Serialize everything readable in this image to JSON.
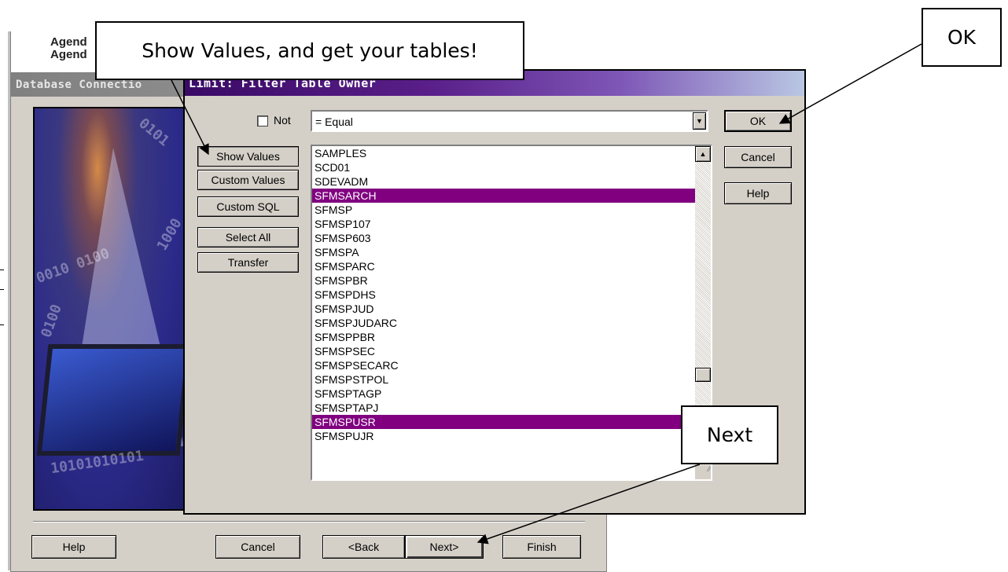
{
  "background": {
    "agency_lines": [
      "Agend",
      "Agend"
    ],
    "window_title": "Database Connectio",
    "hero_binary": [
      "0101",
      "1000",
      "0010 0100",
      "0100",
      "10101010101"
    ],
    "buttons": {
      "help": "Help",
      "cancel": "Cancel",
      "back": "<Back",
      "next": "Next>",
      "finish": "Finish"
    }
  },
  "dialog": {
    "title": "Limit: Filter Table Owner",
    "not_label": "Not",
    "operator_value": "= Equal",
    "side_buttons": [
      "Show Values",
      "Custom Values",
      "Custom SQL",
      "Select All",
      "Transfer"
    ],
    "right_buttons": {
      "ok": "OK",
      "cancel": "Cancel",
      "help": "Help"
    },
    "list_items": [
      {
        "text": "SAMPLES",
        "selected": false
      },
      {
        "text": "SCD01",
        "selected": false
      },
      {
        "text": "SDEVADM",
        "selected": false
      },
      {
        "text": "SFMSARCH",
        "selected": true
      },
      {
        "text": "SFMSP",
        "selected": false
      },
      {
        "text": "SFMSP107",
        "selected": false
      },
      {
        "text": "SFMSP603",
        "selected": false
      },
      {
        "text": "SFMSPA",
        "selected": false
      },
      {
        "text": "SFMSPARC",
        "selected": false
      },
      {
        "text": "SFMSPBR",
        "selected": false
      },
      {
        "text": "SFMSPDHS",
        "selected": false
      },
      {
        "text": "SFMSPJUD",
        "selected": false
      },
      {
        "text": "SFMSPJUDARC",
        "selected": false
      },
      {
        "text": "SFMSPPBR",
        "selected": false
      },
      {
        "text": "SFMSPSEC",
        "selected": false
      },
      {
        "text": "SFMSPSECARC",
        "selected": false
      },
      {
        "text": "SFMSPSTPOL",
        "selected": false
      },
      {
        "text": "SFMSPTAGP",
        "selected": false
      },
      {
        "text": "SFMSPTAPJ",
        "selected": false
      },
      {
        "text": "SFMSPUSR",
        "selected": true
      },
      {
        "text": "SFMSPUJR",
        "selected": false
      }
    ],
    "colors": {
      "selection": "#800080",
      "title_start": "#3a0a66",
      "title_end": "#b9c7e3"
    }
  },
  "annotations": {
    "show_values_callout": "Show Values, and get your tables!",
    "ok_callout": "OK",
    "next_callout": "Next"
  }
}
